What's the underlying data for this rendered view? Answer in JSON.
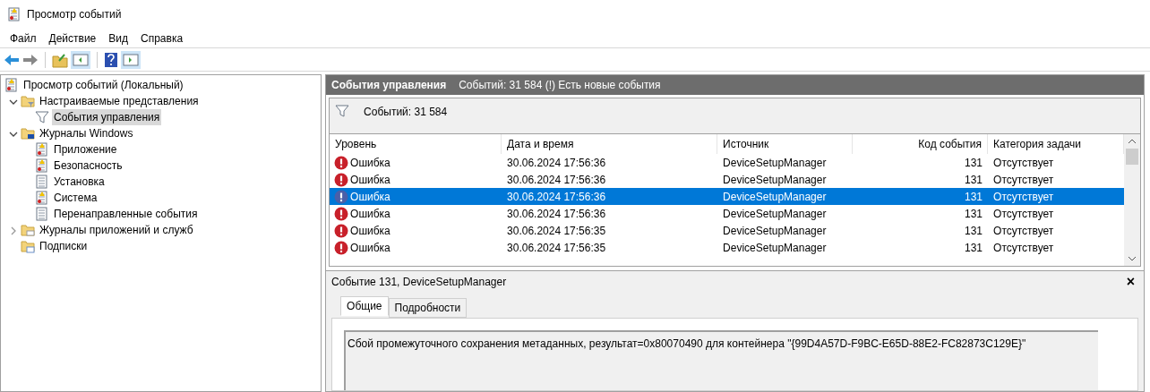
{
  "window": {
    "title": "Просмотр событий"
  },
  "menu": [
    "Файл",
    "Действие",
    "Вид",
    "Справка"
  ],
  "tree": [
    {
      "label": "Просмотр событий (Локальный)",
      "kind": "root",
      "selected": false,
      "children": [
        {
          "label": "Настраиваемые представления",
          "kind": "filter-folder",
          "expanded": true,
          "selected": false,
          "children": [
            {
              "label": "События управления",
              "kind": "filter",
              "selected": true
            }
          ]
        },
        {
          "label": "Журналы Windows",
          "kind": "windows-folder",
          "expanded": true,
          "selected": false,
          "children": [
            {
              "label": "Приложение",
              "kind": "log-warn",
              "selected": false
            },
            {
              "label": "Безопасность",
              "kind": "log-warn",
              "selected": false
            },
            {
              "label": "Установка",
              "kind": "log",
              "selected": false
            },
            {
              "label": "Система",
              "kind": "log-warn",
              "selected": false
            },
            {
              "label": "Перенаправленные события",
              "kind": "log",
              "selected": false
            }
          ]
        },
        {
          "label": "Журналы приложений и служб",
          "kind": "folder",
          "expanded": false,
          "selected": false
        },
        {
          "label": "Подписки",
          "kind": "subs-folder",
          "selected": false
        }
      ]
    }
  ],
  "panel": {
    "title": "События управления",
    "info": "Событий: 31 584 (!) Есть новые события",
    "filter_text": "Событий: 31 584"
  },
  "table": {
    "columns": [
      "Уровень",
      "Дата и время",
      "Источник",
      "Код события",
      "Категория задачи"
    ],
    "rows": [
      {
        "level": "Ошибка",
        "date": "30.06.2024 17:56:36",
        "source": "DeviceSetupManager",
        "code": "131",
        "category": "Отсутствует",
        "selected": false
      },
      {
        "level": "Ошибка",
        "date": "30.06.2024 17:56:36",
        "source": "DeviceSetupManager",
        "code": "131",
        "category": "Отсутствует",
        "selected": false
      },
      {
        "level": "Ошибка",
        "date": "30.06.2024 17:56:36",
        "source": "DeviceSetupManager",
        "code": "131",
        "category": "Отсутствует",
        "selected": true
      },
      {
        "level": "Ошибка",
        "date": "30.06.2024 17:56:36",
        "source": "DeviceSetupManager",
        "code": "131",
        "category": "Отсутствует",
        "selected": false
      },
      {
        "level": "Ошибка",
        "date": "30.06.2024 17:56:35",
        "source": "DeviceSetupManager",
        "code": "131",
        "category": "Отсутствует",
        "selected": false
      },
      {
        "level": "Ошибка",
        "date": "30.06.2024 17:56:35",
        "source": "DeviceSetupManager",
        "code": "131",
        "category": "Отсутствует",
        "selected": false
      }
    ]
  },
  "details": {
    "title": "Событие 131, DeviceSetupManager",
    "close": "×",
    "tabs": [
      {
        "label": "Общие",
        "selected": true
      },
      {
        "label": "Подробности",
        "selected": false
      }
    ],
    "message": "Сбой промежуточного сохранения метаданных, результат=0x80070490 для контейнера \"{99D4A57D-F9BC-E65D-88E2-FC82873C129E}\""
  }
}
